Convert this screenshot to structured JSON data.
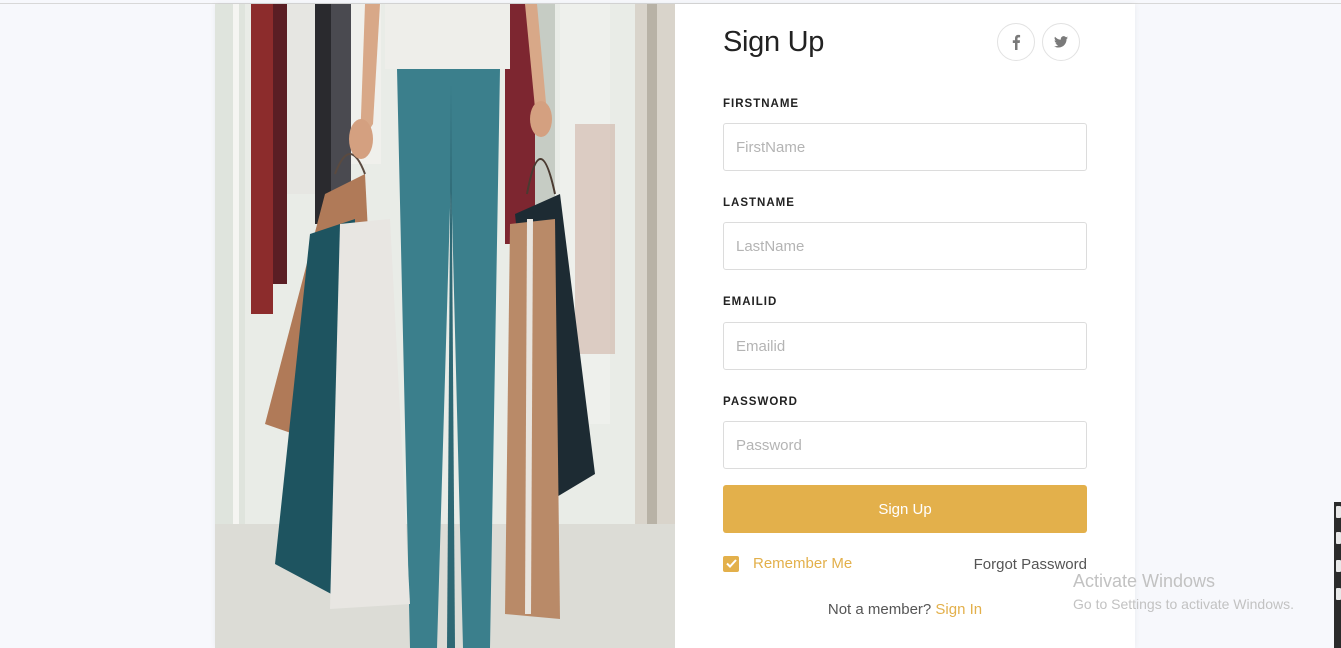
{
  "form": {
    "title": "Sign Up",
    "social": [
      "facebook-icon",
      "twitter-icon"
    ],
    "fields": {
      "firstname": {
        "label": "FIRSTNAME",
        "placeholder": "FirstName"
      },
      "lastname": {
        "label": "LASTNAME",
        "placeholder": "LastName"
      },
      "email": {
        "label": "EMAILID",
        "placeholder": "Emailid"
      },
      "password": {
        "label": "PASSWORD",
        "placeholder": "Password"
      }
    },
    "submit_label": "Sign Up",
    "remember_label": "Remember Me",
    "remember_checked": true,
    "forgot_label": "Forgot Password",
    "member_prompt": "Not a member?",
    "signin_label": "Sign In"
  },
  "colors": {
    "accent": "#e3b04b",
    "text": "#222222",
    "muted": "#555555"
  },
  "watermark": {
    "title": "Activate Windows",
    "subtitle": "Go to Settings to activate Windows."
  }
}
